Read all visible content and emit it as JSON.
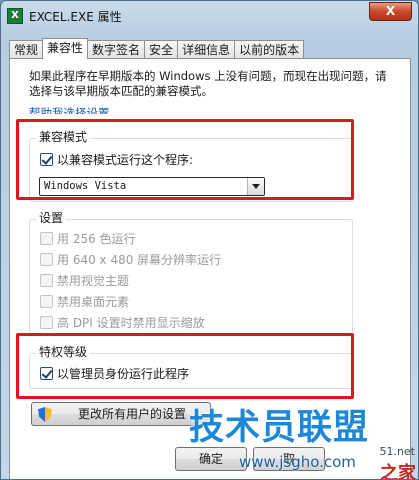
{
  "window": {
    "title": "EXCEL.EXE 属性",
    "app_icon": "X",
    "close_label": "X"
  },
  "tabs": [
    {
      "label": "常规"
    },
    {
      "label": "兼容性"
    },
    {
      "label": "数字签名"
    },
    {
      "label": "安全"
    },
    {
      "label": "详细信息"
    },
    {
      "label": "以前的版本"
    }
  ],
  "active_tab": "兼容性",
  "intro": "如果此程序在早期版本的 Windows 上没有问题，而现在出现问题，请选择与该早期版本匹配的兼容模式。",
  "help_link": "帮助我选择设置",
  "compat_mode": {
    "label": "兼容模式",
    "checkbox_label": "以兼容模式运行这个程序:",
    "checked": true,
    "selected_os": "Windows Vista"
  },
  "settings": {
    "label": "设置",
    "options": [
      {
        "label": "用 256 色运行",
        "checked": false
      },
      {
        "label": "用 640 x 480 屏幕分辨率运行",
        "checked": false
      },
      {
        "label": "禁用视觉主题",
        "checked": false
      },
      {
        "label": "禁用桌面元素",
        "checked": false
      },
      {
        "label": "高 DPI 设置时禁用显示缩放",
        "checked": false
      }
    ]
  },
  "privilege": {
    "label": "特权等级",
    "checkbox_label": "以管理员身份运行此程序",
    "checked": true
  },
  "buttons": {
    "change_all_users": "更改所有用户的设置",
    "ok": "确定",
    "cancel": "取"
  },
  "watermark": {
    "text": "技术员联盟",
    "url": "www.jsgho.com",
    "side": "51.net",
    "corner": "之家"
  },
  "colors": {
    "highlight_box": "#e2141e",
    "link": "#0b5fb0",
    "watermark": "#1e88d8"
  }
}
